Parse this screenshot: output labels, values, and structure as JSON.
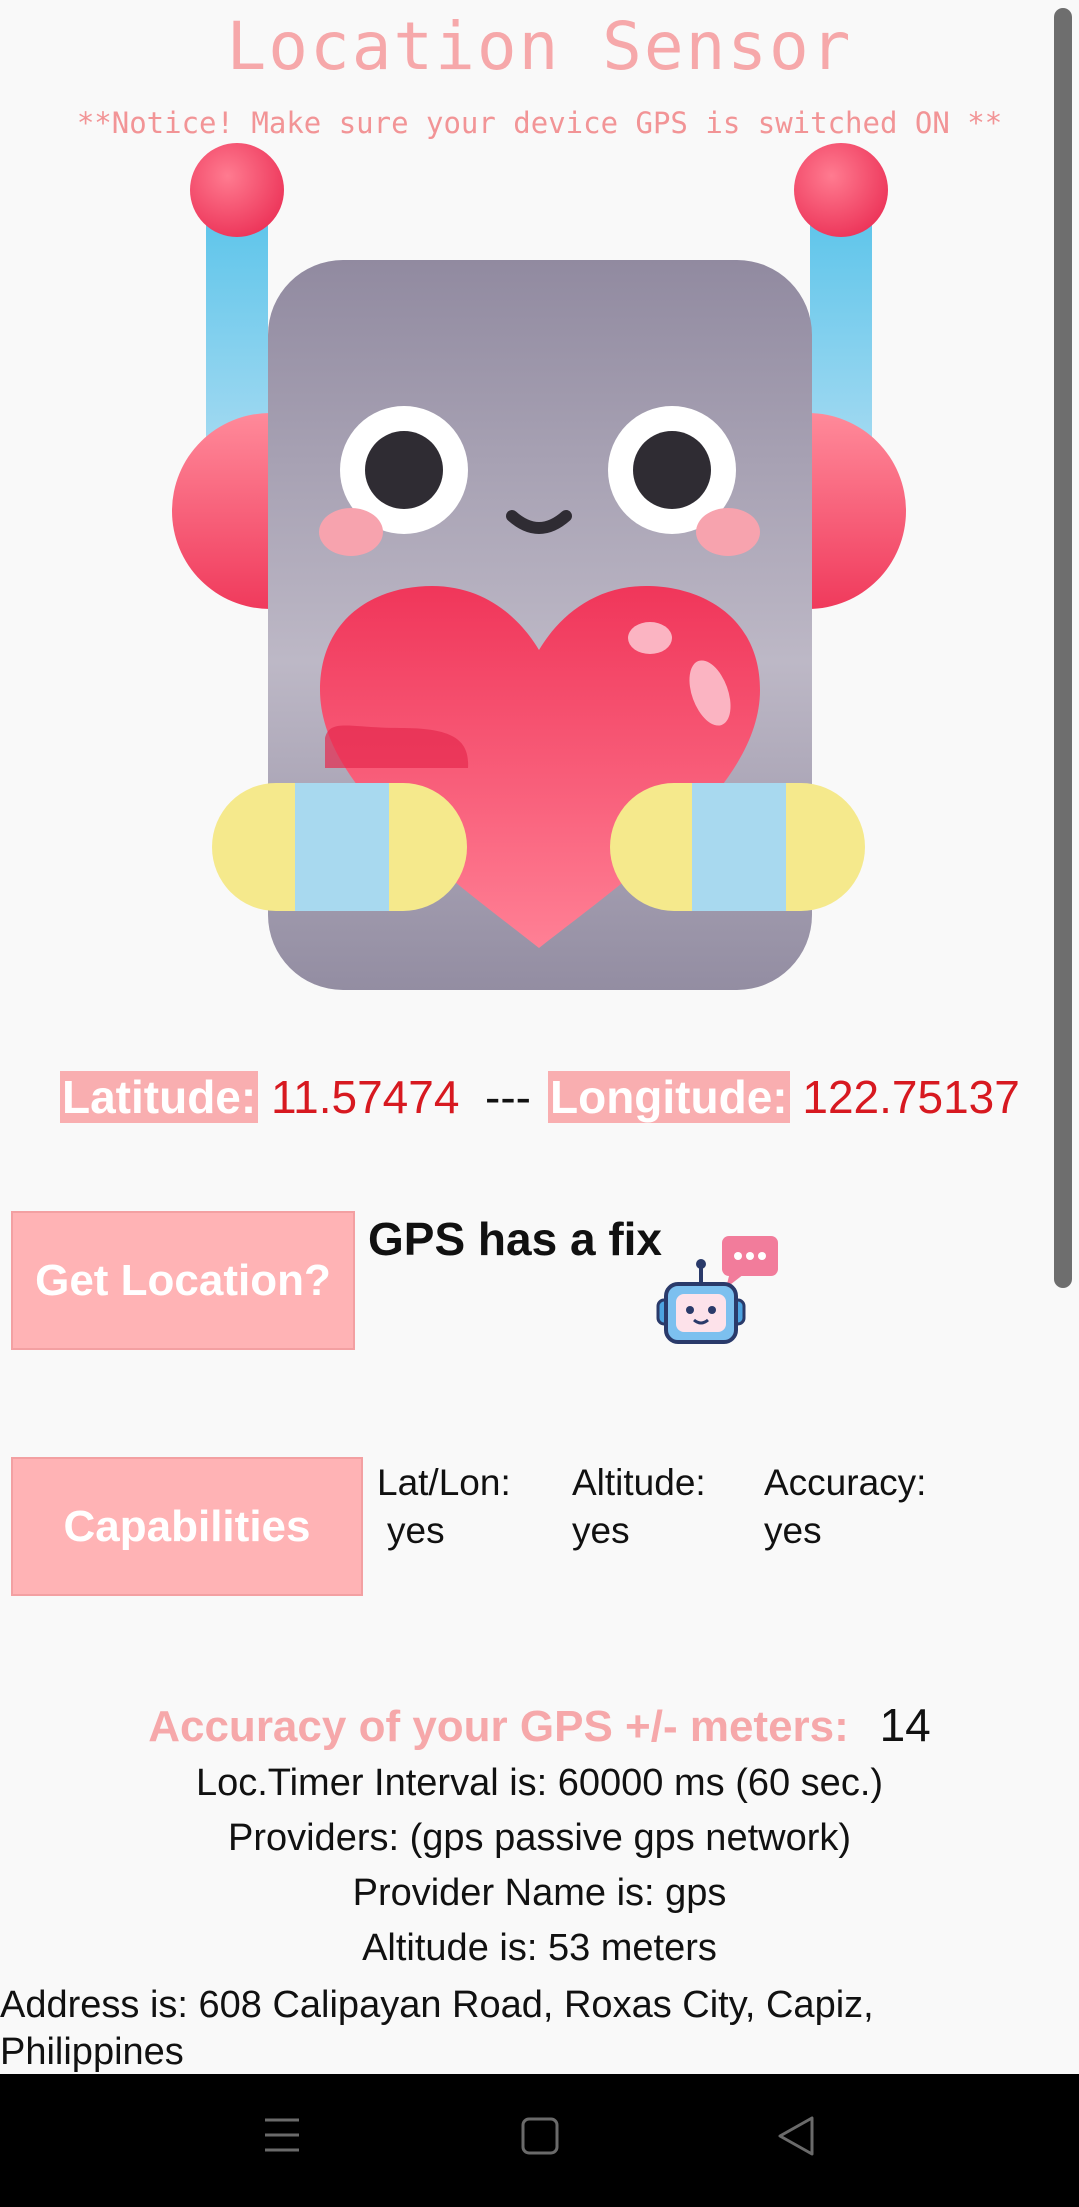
{
  "header": {
    "title": "Location Sensor",
    "notice": "**Notice! Make sure your device GPS is switched ON **"
  },
  "illustration": {
    "name": "robot-holding-heart"
  },
  "coordinates": {
    "latitude_label": "Latitude:",
    "latitude_value": "11.57474",
    "separator": "---",
    "longitude_label": "Longitude:",
    "longitude_value": "122.75137"
  },
  "location": {
    "button_label": "Get Location?",
    "status": "GPS has a fix"
  },
  "capabilities": {
    "button_label": "Capabilities",
    "latlon_label": "Lat/Lon:",
    "latlon_value": "yes",
    "altitude_label": "Altitude:",
    "altitude_value": "yes",
    "accuracy_label": "Accuracy:",
    "accuracy_value": "yes"
  },
  "details": {
    "accuracy_label": "Accuracy of your GPS +/- meters:",
    "accuracy_value": "14",
    "timer": "Loc.Timer Interval is:  60000 ms (60 sec.)",
    "providers": "Providers: (gps passive gps network)",
    "provider_name": "Provider Name is: gps",
    "altitude": "Altitude is:  53 meters",
    "address_line1": "Address is: 608 Calipayan Road, Roxas City, Capiz,",
    "address_line2": "Philippines"
  },
  "colors": {
    "accent_pink": "#ffb3b5",
    "title_pink": "#f6a8aa",
    "value_red": "#d71920"
  },
  "nav": {
    "menu_icon": "menu-icon",
    "home_icon": "square-icon",
    "back_icon": "back-triangle-icon"
  }
}
